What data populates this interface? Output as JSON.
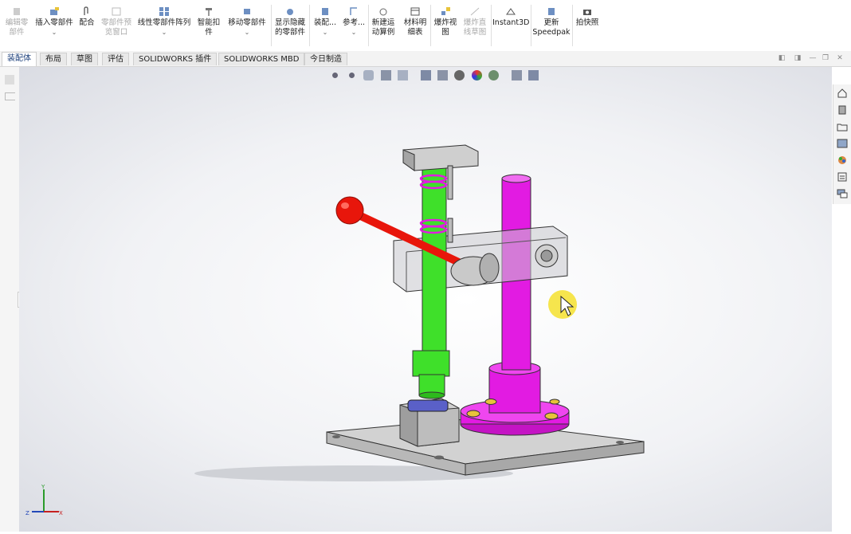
{
  "ribbon": {
    "buttons": [
      {
        "label": "编辑零\n部件",
        "disabled": true
      },
      {
        "label": "插入零部件",
        "disabled": false
      },
      {
        "label": "配合",
        "disabled": false
      },
      {
        "label": "零部件预\n览窗口",
        "disabled": true
      },
      {
        "label": "线性零部件阵列",
        "disabled": false
      },
      {
        "label": "智能扣\n件",
        "disabled": false
      },
      {
        "label": "移动零部件",
        "disabled": false
      },
      {
        "label": "显示隐藏\n的零部件",
        "disabled": false
      },
      {
        "label": "装配...",
        "disabled": false
      },
      {
        "label": "参考...",
        "disabled": false
      },
      {
        "label": "新建运\n动算例",
        "disabled": false
      },
      {
        "label": "材料明\n细表",
        "disabled": false
      },
      {
        "label": "爆炸视\n图",
        "disabled": false
      },
      {
        "label": "爆炸直\n线草图",
        "disabled": true
      },
      {
        "label": "Instant3D",
        "disabled": false
      },
      {
        "label": "更新\nSpeedpak",
        "disabled": false
      },
      {
        "label": "拍快照",
        "disabled": false
      }
    ]
  },
  "tabs": [
    {
      "label": "装配体",
      "active": true
    },
    {
      "label": "布局",
      "active": false
    },
    {
      "label": "草图",
      "active": false
    },
    {
      "label": "评估",
      "active": false
    },
    {
      "label": "SOLIDWORKS 插件",
      "active": false
    },
    {
      "label": "SOLIDWORKS MBD",
      "active": false
    },
    {
      "label": "今日制造",
      "active": false
    }
  ],
  "heads_up_toolbar": [
    "zoom-to-fit-icon",
    "zoom-area-icon",
    "previous-view-icon",
    "section-view-icon",
    "dynamic-annotation-icon",
    "view-orientation-icon",
    "display-style-icon",
    "hide-show-icon",
    "edit-appearance-icon",
    "apply-scene-icon",
    "view-settings-icon",
    "display-pane-icon"
  ],
  "task_pane": [
    "home-icon",
    "design-library-icon",
    "file-explorer-icon",
    "view-palette-icon",
    "appearances-icon",
    "custom-properties-icon",
    "forum-icon"
  ],
  "triad": {
    "x": "X",
    "y": "Y",
    "z": "Z"
  },
  "colors": {
    "green_part": "#3fe02a",
    "magenta_part": "#e21be2",
    "red_handle": "#e8160b",
    "gray_part": "#c9c9c9",
    "ribbon_bg": "#ffffff"
  }
}
